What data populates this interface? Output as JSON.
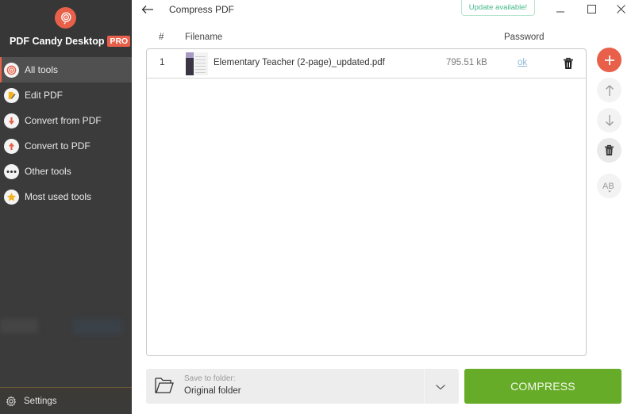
{
  "app": {
    "brand_name": "PDF Candy Desktop",
    "brand_badge": "PRO",
    "accent_color": "#e8604a",
    "primary_button_color": "#67ac29"
  },
  "sidebar": {
    "items": [
      {
        "label": "All tools",
        "icon": "spiral-icon",
        "active": true
      },
      {
        "label": "Edit PDF",
        "icon": "pencil-icon",
        "active": false
      },
      {
        "label": "Convert from PDF",
        "icon": "arrow-down-icon",
        "active": false
      },
      {
        "label": "Convert to PDF",
        "icon": "arrow-up-icon",
        "active": false
      },
      {
        "label": "Other tools",
        "icon": "ellipsis-icon",
        "active": false
      },
      {
        "label": "Most used tools",
        "icon": "star-icon",
        "active": false
      }
    ],
    "settings_label": "Settings"
  },
  "topbar": {
    "title": "Compress PDF",
    "update_label": "Update available!"
  },
  "table": {
    "columns": [
      "#",
      "Filename",
      "Password"
    ],
    "rows": [
      {
        "index": "1",
        "filename": "Elementary Teacher (2-page)_updated.pdf",
        "size": "795.51 kB",
        "password": "ok"
      }
    ]
  },
  "footer": {
    "save_label": "Save to folder:",
    "save_value": "Original folder",
    "compress_label": "COMPRESS"
  }
}
